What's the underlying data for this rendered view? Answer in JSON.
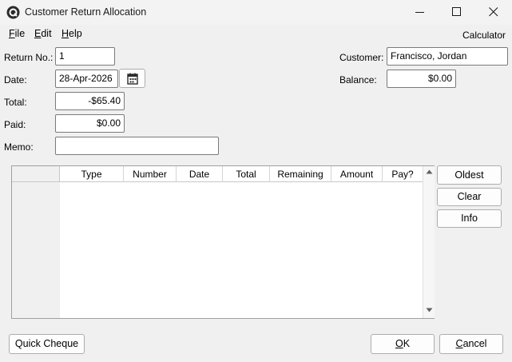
{
  "window": {
    "title": "Customer Return Allocation",
    "icon": "q-logo-icon"
  },
  "menu": {
    "file_first": "F",
    "file_rest": "ile",
    "edit_first": "E",
    "edit_rest": "dit",
    "help_first": "H",
    "help_rest": "elp",
    "calculator": "Calculator"
  },
  "form": {
    "return_no_label": "Return No.:",
    "return_no_value": "1",
    "date_label": "Date:",
    "date_value": "28-Apr-2026",
    "total_label": "Total:",
    "total_value": "-$65.40",
    "paid_label": "Paid:",
    "paid_value": "$0.00",
    "memo_label": "Memo:",
    "memo_value": "",
    "customer_label": "Customer:",
    "customer_value": "Francisco, Jordan",
    "balance_label": "Balance:",
    "balance_value": "$0.00"
  },
  "grid": {
    "columns": [
      "Type",
      "Number",
      "Date",
      "Total",
      "Remaining",
      "Amount",
      "Pay?"
    ],
    "rows": []
  },
  "buttons": {
    "oldest": "Oldest",
    "clear": "Clear",
    "info": "Info",
    "quick_cheque": "Quick Cheque",
    "ok_first": "O",
    "ok_rest": "K",
    "cancel_first": "C",
    "cancel_rest": "ancel"
  }
}
